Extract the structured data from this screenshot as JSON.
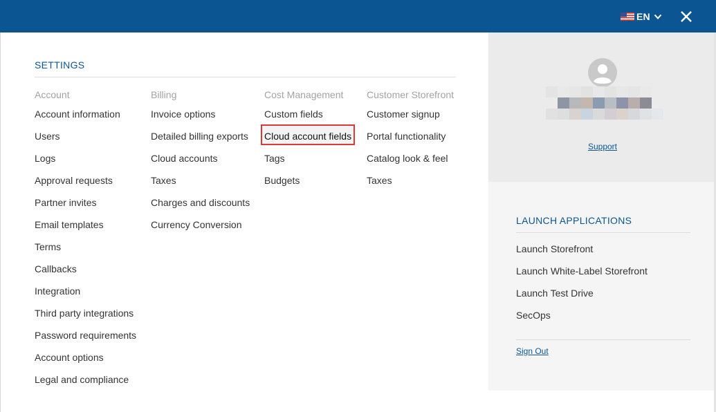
{
  "header": {
    "language_code": "EN",
    "colors": {
      "bar": "#0a5592",
      "text": "#ffffff"
    },
    "icons": [
      "us-flag-icon",
      "chevron-down-icon",
      "close-icon"
    ]
  },
  "settings": {
    "title": "SETTINGS",
    "columns": [
      {
        "heading": "Account",
        "items": [
          "Account information",
          "Users",
          "Logs",
          "Approval requests",
          "Partner invites",
          "Email templates",
          "Terms",
          "Callbacks",
          "Integration",
          "Third party integrations",
          "Password requirements",
          "Account options",
          "Legal and compliance"
        ]
      },
      {
        "heading": "Billing",
        "items": [
          "Invoice options",
          "Detailed billing exports",
          "Cloud accounts",
          "Taxes",
          "Charges and discounts",
          "Currency Conversion"
        ]
      },
      {
        "heading": "Cost Management",
        "items": [
          "Custom fields",
          "Cloud account fields",
          "Tags",
          "Budgets"
        ],
        "highlighted_item": "Cloud account fields",
        "highlight_color": "#d83a3a"
      },
      {
        "heading": "Customer Storefront",
        "items": [
          "Customer signup",
          "Portal functionality",
          "Catalog look & feel",
          "Taxes"
        ]
      }
    ]
  },
  "profile": {
    "support_label": "Support",
    "icons": [
      "user-avatar-icon"
    ]
  },
  "launch": {
    "title": "LAUNCH APPLICATIONS",
    "items": [
      "Launch Storefront",
      "Launch White-Label Storefront",
      "Launch Test Drive",
      "SecOps"
    ],
    "sign_out_label": "Sign Out"
  },
  "colors": {
    "accent": "#0a5592",
    "heading_gray": "#a3a3a3",
    "text": "#333333",
    "profile_panel": "#ebebeb",
    "launch_panel": "#f5f5f5"
  }
}
